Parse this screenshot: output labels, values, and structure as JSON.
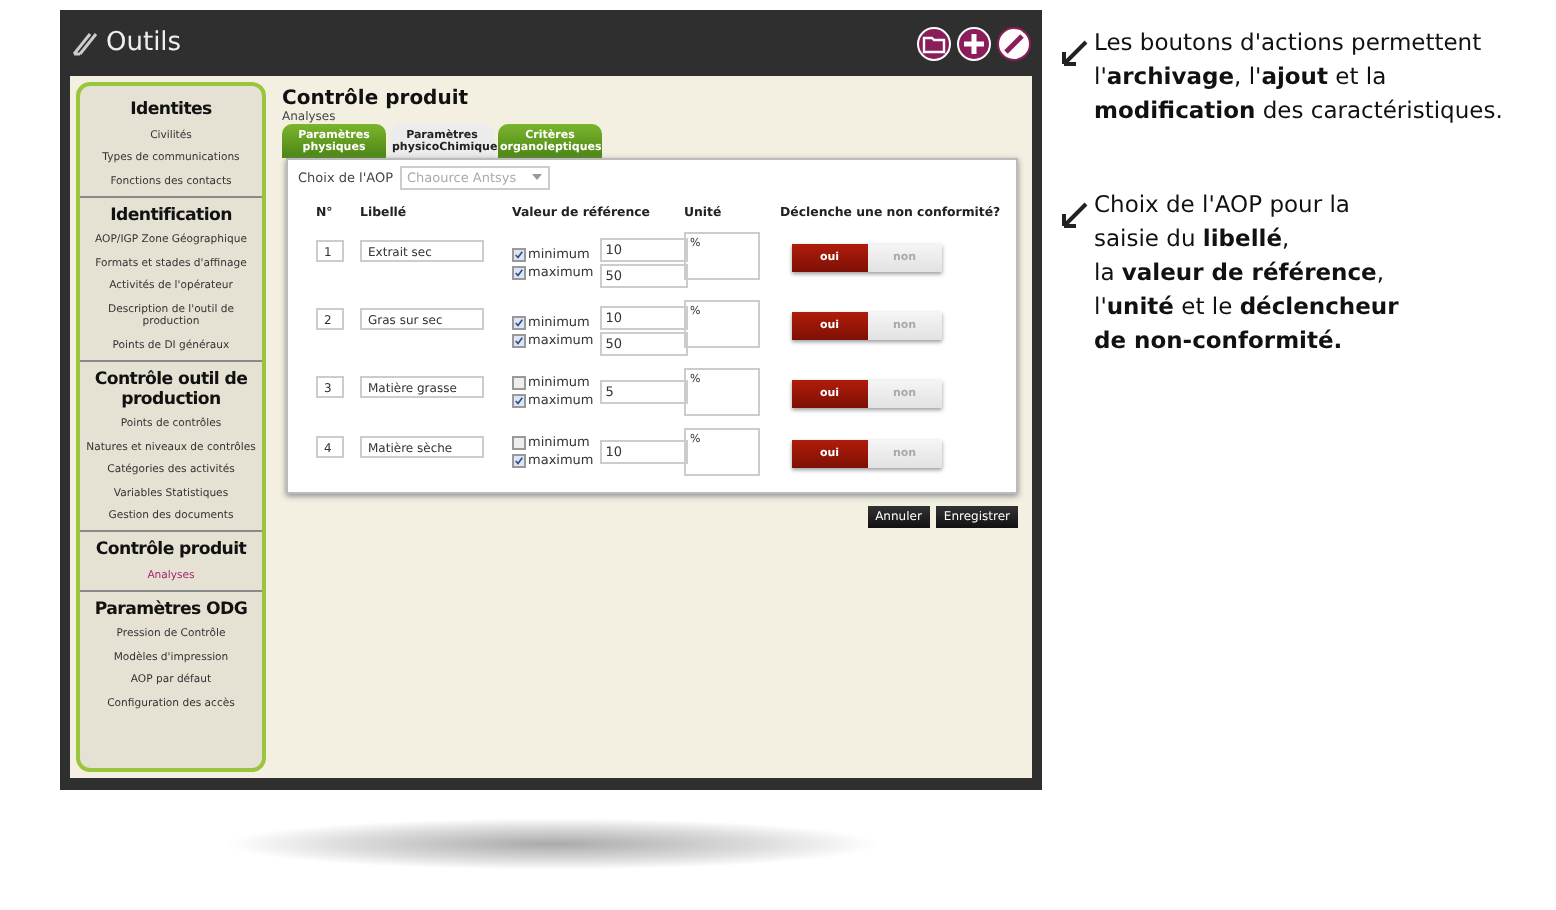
{
  "window": {
    "title": "Outils"
  },
  "sidebar": [
    {
      "heading": "Identites",
      "items": [
        {
          "label": "Civilités",
          "selected": false
        },
        {
          "label": "Types de communications",
          "selected": false
        },
        {
          "label": "Fonctions des contacts",
          "selected": false
        }
      ]
    },
    {
      "heading": "Identification",
      "items": [
        {
          "label": "AOP/IGP Zone Géographique",
          "selected": false
        },
        {
          "label": "Formats et stades d'affinage",
          "selected": false
        },
        {
          "label": "Activités de l'opérateur",
          "selected": false
        },
        {
          "label": "Description de l'outil de production",
          "selected": false
        },
        {
          "label": "Points de DI généraux",
          "selected": false
        }
      ]
    },
    {
      "heading": "Contrôle outil de production",
      "items": [
        {
          "label": "Points de contrôles",
          "selected": false
        },
        {
          "label": "Natures et niveaux de contrôles",
          "selected": false
        },
        {
          "label": "Catégories des activités",
          "selected": false
        },
        {
          "label": "Variables Statistiques",
          "selected": false
        },
        {
          "label": "Gestion des documents",
          "selected": false
        }
      ]
    },
    {
      "heading": "Contrôle produit",
      "items": [
        {
          "label": "Analyses",
          "selected": true
        }
      ]
    },
    {
      "heading": "Paramètres ODG",
      "items": [
        {
          "label": "Pression de Contrôle",
          "selected": false
        },
        {
          "label": "Modèles d'impression",
          "selected": false
        },
        {
          "label": "AOP par défaut",
          "selected": false
        },
        {
          "label": "Configuration des accès",
          "selected": false
        }
      ]
    }
  ],
  "page": {
    "title": "Contrôle produit",
    "subtitle": "Analyses"
  },
  "tabs": [
    {
      "label": "Paramètres physiques",
      "selected": false
    },
    {
      "label": "Paramètres physicoChimique",
      "selected": true
    },
    {
      "label": "Critères organoleptiques",
      "selected": false
    }
  ],
  "aop": {
    "label": "Choix de l'AOP",
    "value": "Chaource Antsys"
  },
  "table": {
    "columns": [
      "N°",
      "Libellé",
      "Valeur de référence",
      "Unité",
      "Déclenche une non conformité?"
    ],
    "rows": [
      {
        "number": "1",
        "label": "Extrait sec",
        "minimum": {
          "label": "minimum",
          "checked": true
        },
        "maximum": {
          "label": "maximum",
          "checked": true
        },
        "values": [
          "10",
          "50"
        ],
        "unit": "%",
        "toggle": [
          {
            "label": "oui",
            "selected": true
          },
          {
            "label": "non",
            "selected": false
          }
        ]
      },
      {
        "number": "2",
        "label": "Gras sur sec",
        "minimum": {
          "label": "minimum",
          "checked": true
        },
        "maximum": {
          "label": "maximum",
          "checked": true
        },
        "values": [
          "10",
          "50"
        ],
        "unit": "%",
        "toggle": [
          {
            "label": "oui",
            "selected": true
          },
          {
            "label": "non",
            "selected": false
          }
        ]
      },
      {
        "number": "3",
        "label": "Matière grasse",
        "minimum": {
          "label": "minimum",
          "checked": false
        },
        "maximum": {
          "label": "maximum",
          "checked": true
        },
        "values": [
          "5"
        ],
        "unit": "%",
        "toggle": [
          {
            "label": "oui",
            "selected": true
          },
          {
            "label": "non",
            "selected": false
          }
        ]
      },
      {
        "number": "4",
        "label": "Matière sèche",
        "minimum": {
          "label": "minimum",
          "checked": false
        },
        "maximum": {
          "label": "maximum",
          "checked": true
        },
        "values": [
          "10"
        ],
        "unit": "%",
        "toggle": [
          {
            "label": "oui",
            "selected": true
          },
          {
            "label": "non",
            "selected": false
          }
        ]
      }
    ]
  },
  "buttons": [
    "Annuler",
    "Enregistrer"
  ],
  "annotations": [
    {
      "lines": [
        "Les boutons d'actions permettent",
        "l'**archivage**, l'**ajout** et la",
        "**modification** des caractéristiques."
      ]
    },
    {
      "lines": [
        "Choix de l'AOP pour la",
        "saisie du **libellé**,",
        "la **valeur de référence**,",
        "l'**unité** et le **déclencheur**",
        "**de non-conformité.**"
      ]
    }
  ]
}
